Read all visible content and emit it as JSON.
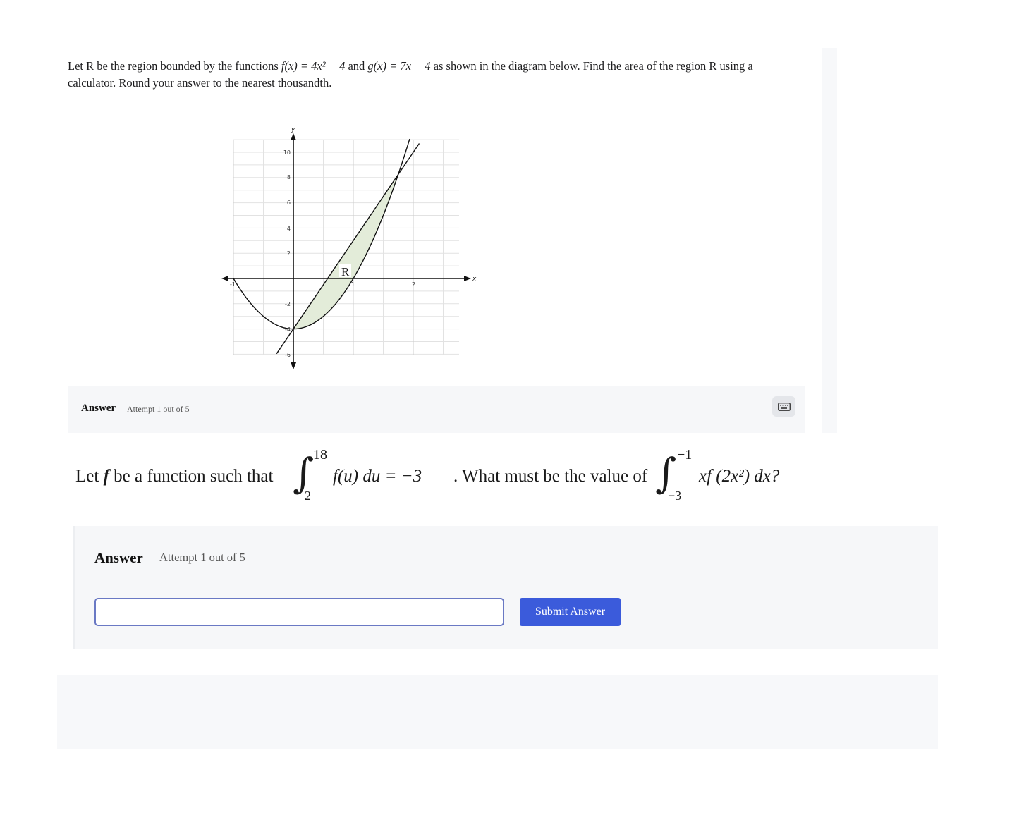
{
  "question1": {
    "text_before_f": "Let R be the region bounded by the functions ",
    "f_expr": "f(x) = 4x² − 4",
    "text_and": " and ",
    "g_expr": "g(x) = 7x − 4",
    "text_after": " as shown in the diagram below. Find the area of the region R using a calculator. Round your answer to the nearest thousandth."
  },
  "graph": {
    "x_axis_label": "x",
    "y_axis_label": "y",
    "x_ticks": [
      "-1",
      "1",
      "2"
    ],
    "y_ticks": [
      "10",
      "8",
      "6",
      "4",
      "2",
      "-2",
      "-4",
      "-6"
    ],
    "region_label": "R",
    "region_fill": "#e3ecd9"
  },
  "answer1": {
    "label": "Answer",
    "attempt": "Attempt 1 out of 5",
    "keyboard_icon": "keyboard-icon"
  },
  "question2": {
    "let": "Let ",
    "f": "f",
    "be_function": " be a function such that",
    "int1_upper": "18",
    "int1_lower": "2",
    "int1_body": "f(u) du = −3",
    "what_must": ". What must be the value of",
    "int2_upper": "−1",
    "int2_lower": "−3",
    "int2_body": "xf (2x²) dx?"
  },
  "answer2": {
    "label": "Answer",
    "attempt": "Attempt 1 out of 5",
    "input_value": "",
    "submit_label": "Submit Answer"
  },
  "colors": {
    "accent": "#3b5bdb",
    "panel": "#f6f7f9"
  }
}
